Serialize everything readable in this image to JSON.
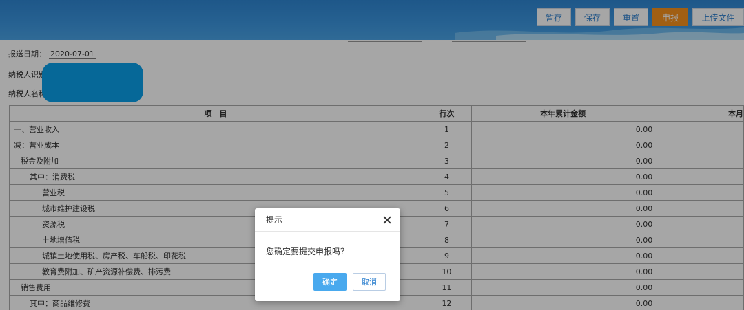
{
  "toolbar": {
    "buttons": [
      {
        "label": "暂存"
      },
      {
        "label": "保存"
      },
      {
        "label": "重置"
      },
      {
        "label": "申报"
      },
      {
        "label": "上传文件"
      }
    ]
  },
  "form": {
    "report_date_label": "报送日期：",
    "report_date_value": "2020-07-01",
    "taxpayer_id_label": "纳税人识别号",
    "taxpayer_name_label": "纳税人名称："
  },
  "table": {
    "headers": [
      "项　目",
      "行次",
      "本年累计金额",
      "本月"
    ],
    "rows": [
      {
        "item": "一、营业收入",
        "line": "1",
        "amount": "0.00",
        "indent": 0
      },
      {
        "item": "减：营业成本",
        "line": "2",
        "amount": "0.00",
        "indent": 0
      },
      {
        "item": "税金及附加",
        "line": "3",
        "amount": "0.00",
        "indent": 1
      },
      {
        "item": "其中：消费税",
        "line": "4",
        "amount": "0.00",
        "indent": 2
      },
      {
        "item": "营业税",
        "line": "5",
        "amount": "0.00",
        "indent": 3
      },
      {
        "item": "城市维护建设税",
        "line": "6",
        "amount": "0.00",
        "indent": 3
      },
      {
        "item": "资源税",
        "line": "7",
        "amount": "0.00",
        "indent": 3
      },
      {
        "item": "土地增值税",
        "line": "8",
        "amount": "0.00",
        "indent": 3
      },
      {
        "item": "城镇土地使用税、房产税、车船税、印花税",
        "line": "9",
        "amount": "0.00",
        "indent": 3
      },
      {
        "item": "教育费附加、矿产资源补偿费、排污费",
        "line": "10",
        "amount": "0.00",
        "indent": 3
      },
      {
        "item": "销售费用",
        "line": "11",
        "amount": "0.00",
        "indent": 1
      },
      {
        "item": "其中：商品维修费",
        "line": "12",
        "amount": "0.00",
        "indent": 2
      }
    ]
  },
  "dialog": {
    "title": "提示",
    "message": "您确定要提交申报吗？",
    "ok_label": "确定",
    "cancel_label": "取消"
  },
  "colors": {
    "header_blue": "#3c97e0",
    "submit_orange": "#f7931e",
    "ok_blue": "#49a9ee"
  }
}
